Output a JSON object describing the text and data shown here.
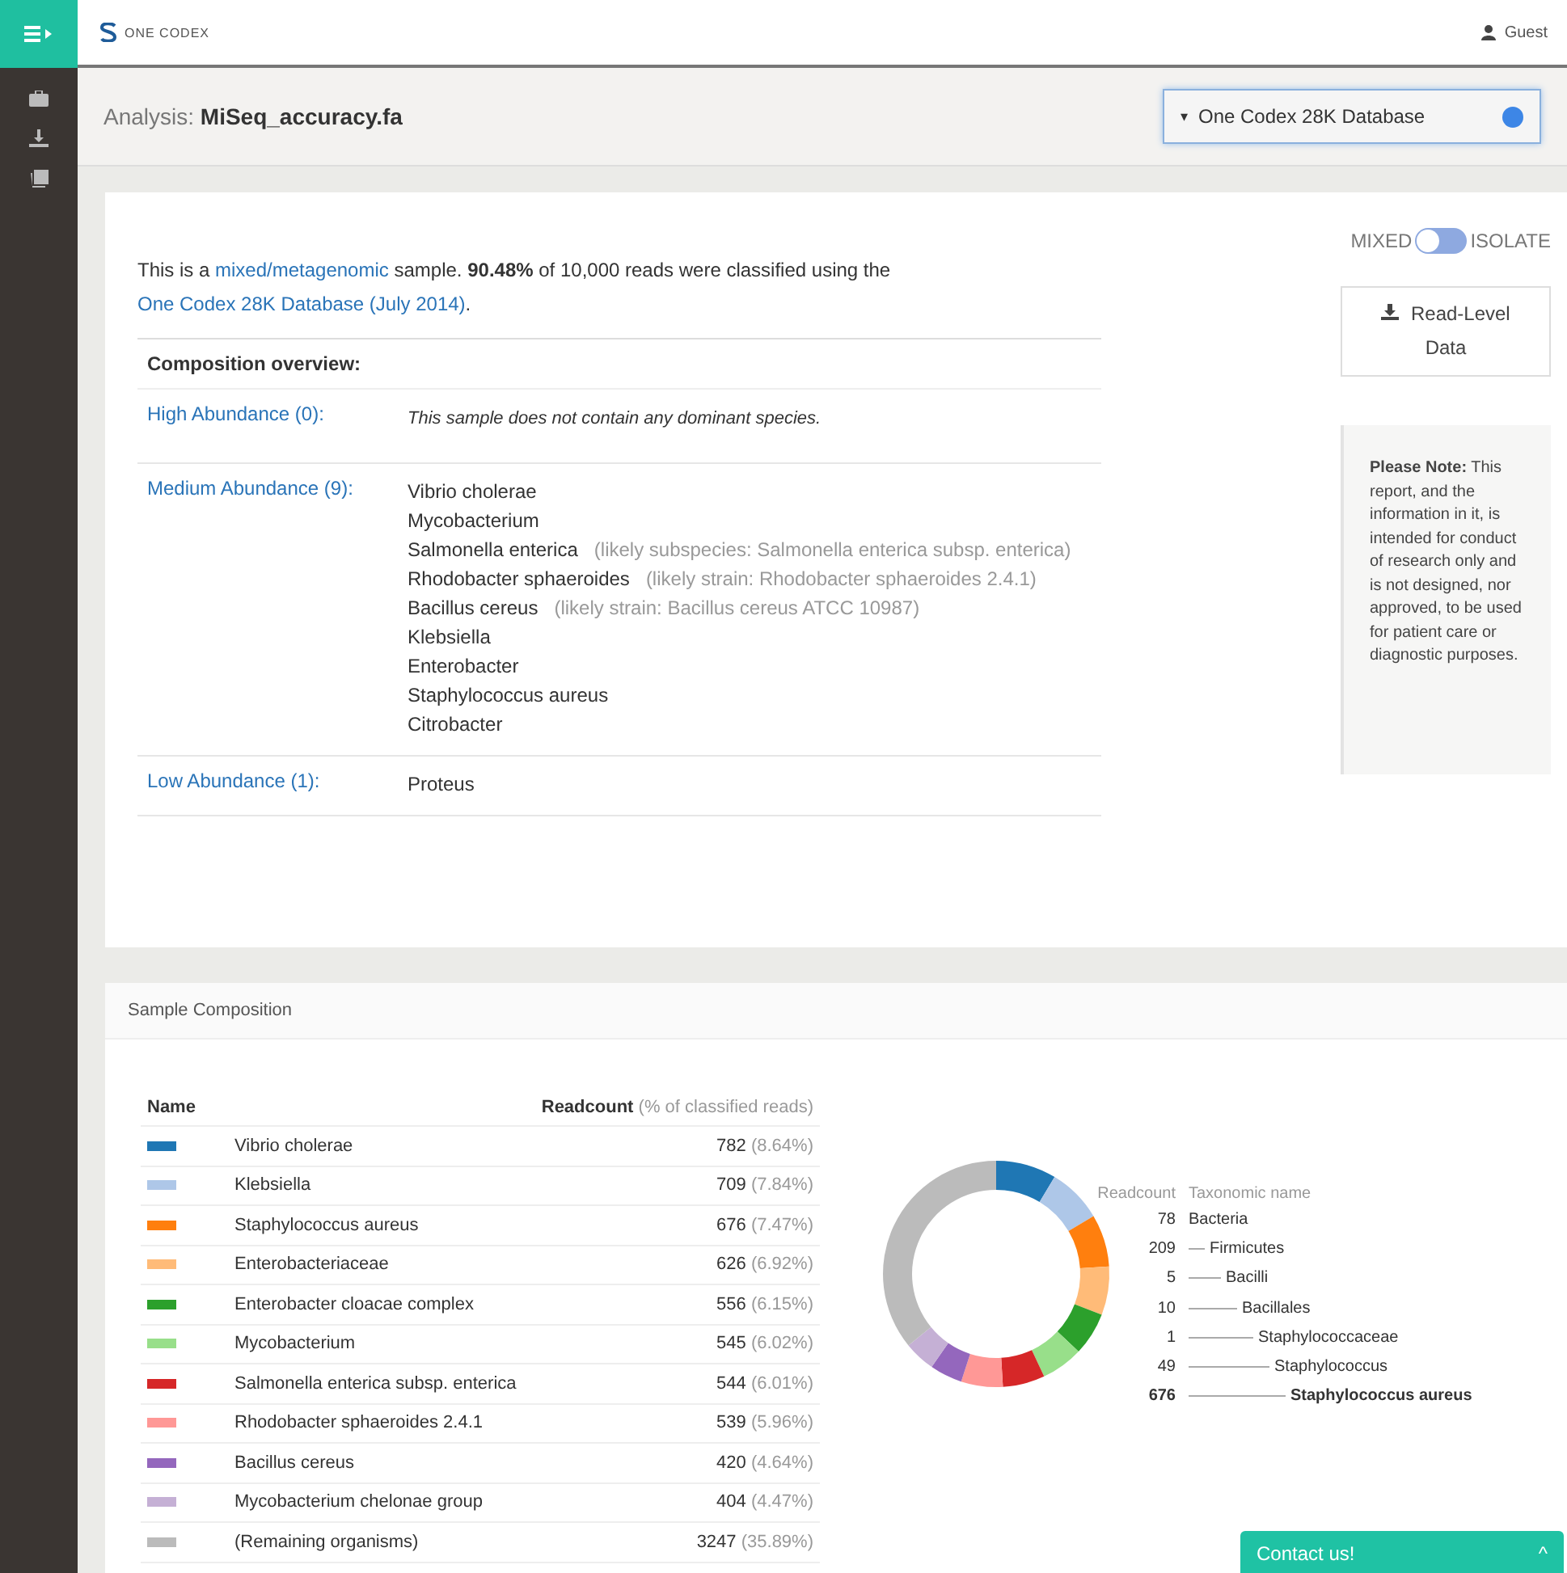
{
  "brand": {
    "name": "ONE CODEX"
  },
  "user": {
    "name": "Guest"
  },
  "analysis": {
    "label": "Analysis:",
    "file": "MiSeq_accuracy.fa"
  },
  "database_select": {
    "value": "One Codex 28K Database",
    "caret": "▾"
  },
  "summary": {
    "parts": [
      {
        "kind": "text",
        "text": "This is a "
      },
      {
        "kind": "link",
        "text": "mixed/metagenomic"
      },
      {
        "kind": "text",
        "text": " sample. **90.48%** of 10,000 reads were classified using the "
      },
      {
        "kind": "link",
        "text": "One Codex 28K Database (July 2014)"
      },
      {
        "kind": "text",
        "text": "."
      }
    ]
  },
  "toggle": {
    "left": "MIXED",
    "right": "ISOLATE",
    "on": false
  },
  "read_level_button": {
    "label": "Read-Level Data"
  },
  "note": {
    "text": "**Please Note:** This report, and the information in it, is intended for conduct of research only and is not designed, nor approved, to be used for patient care or diagnostic purposes."
  },
  "overview": {
    "title": "Composition overview:",
    "groups": [
      {
        "label": "High Abundance (0):",
        "message": "This sample does not contain any dominant species."
      },
      {
        "label": "Medium Abundance (9):",
        "species": [
          {
            "name": "Vibrio cholerae"
          },
          {
            "name": "Mycobacterium"
          },
          {
            "name": "Salmonella enterica",
            "note": "(likely subspecies: Salmonella enterica subsp. enterica)"
          },
          {
            "name": "Rhodobacter sphaeroides",
            "note": "(likely strain: Rhodobacter sphaeroides 2.4.1)"
          },
          {
            "name": "Bacillus cereus",
            "note": "(likely strain: Bacillus cereus ATCC 10987)"
          },
          {
            "name": "Klebsiella"
          },
          {
            "name": "Enterobacter"
          },
          {
            "name": "Staphylococcus aureus"
          },
          {
            "name": "Citrobacter"
          }
        ]
      },
      {
        "label": "Low Abundance (1):",
        "species": [
          {
            "name": "Proteus"
          }
        ]
      }
    ]
  },
  "sample_composition": {
    "title": "Sample Composition",
    "columns": {
      "name": "Name",
      "readcount": "Readcount",
      "readcount_note": "(% of classified reads)"
    },
    "rows": [
      {
        "name": "Vibrio cholerae",
        "count": "782",
        "percent": "(8.64%)",
        "color": "#1f77b4"
      },
      {
        "name": "Klebsiella",
        "count": "709",
        "percent": "(7.84%)",
        "color": "#aec7e8"
      },
      {
        "name": "Staphylococcus aureus",
        "count": "676",
        "percent": "(7.47%)",
        "color": "#ff7f0e"
      },
      {
        "name": "Enterobacteriaceae",
        "count": "626",
        "percent": "(6.92%)",
        "color": "#ffbb78"
      },
      {
        "name": "Enterobacter cloacae complex",
        "count": "556",
        "percent": "(6.15%)",
        "color": "#2ca02c"
      },
      {
        "name": "Mycobacterium",
        "count": "545",
        "percent": "(6.02%)",
        "color": "#98df8a"
      },
      {
        "name": "Salmonella enterica subsp. enterica",
        "count": "544",
        "percent": "(6.01%)",
        "color": "#d62728"
      },
      {
        "name": "Rhodobacter sphaeroides 2.4.1",
        "count": "539",
        "percent": "(5.96%)",
        "color": "#ff9896"
      },
      {
        "name": "Bacillus cereus",
        "count": "420",
        "percent": "(4.64%)",
        "color": "#9467bd"
      },
      {
        "name": "Mycobacterium chelonae group",
        "count": "404",
        "percent": "(4.47%)",
        "color": "#c5b0d5"
      },
      {
        "name": "(Remaining organisms)",
        "count": "3247",
        "percent": "(35.89%)",
        "color": "#bbbbbb"
      }
    ],
    "chart_data": {
      "type": "donut",
      "values": [
        8.64,
        7.84,
        7.47,
        6.92,
        6.15,
        6.02,
        6.01,
        5.96,
        4.64,
        4.47,
        35.89
      ]
    },
    "lineage": {
      "columns": [
        "Readcount",
        "Taxonomic name"
      ],
      "tree": [
        {
          "count": "78",
          "name": "Bacteria",
          "selected": false,
          "children": [
            {
              "count": "209",
              "name": "Firmicutes",
              "selected": false,
              "children": [
                {
                  "count": "5",
                  "name": "Bacilli",
                  "selected": false,
                  "children": [
                    {
                      "count": "10",
                      "name": "Bacillales",
                      "selected": false,
                      "children": [
                        {
                          "count": "1",
                          "name": "Staphylococcaceae",
                          "selected": false,
                          "children": [
                            {
                              "count": "49",
                              "name": "Staphylococcus",
                              "selected": false,
                              "children": [
                                {
                                  "count": "676",
                                  "name": "Staphylococcus aureus",
                                  "selected": true
                                }
                              ]
                            }
                          ]
                        }
                      ]
                    }
                  ]
                }
              ]
            }
          ]
        }
      ]
    }
  },
  "contact": {
    "label": "Contact us!",
    "caret": "^"
  }
}
